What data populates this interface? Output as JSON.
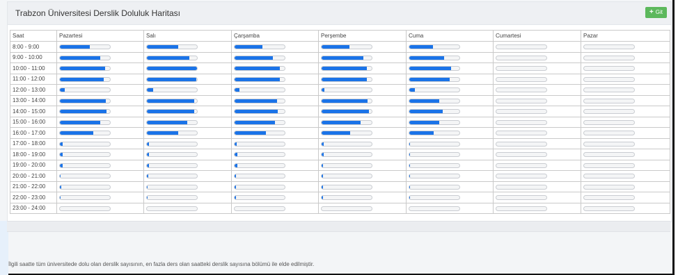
{
  "page": {
    "title": "Trabzon Üniversitesi Derslik Doluluk Haritası",
    "go_button": "Git",
    "note": "İlgili saatte tüm üniversitede dolu olan derslik sayısının, en fazla ders olan saatteki derslik sayısına bölümü ile elde edilmiştir."
  },
  "colors": {
    "bar_fill": "#1a73e8",
    "button": "#5cb85c"
  },
  "table": {
    "columns": [
      "Saat",
      "Pazartesi",
      "Salı",
      "Çarşamba",
      "Perşembe",
      "Cuma",
      "Cumartesi",
      "Pazar"
    ],
    "rows": [
      {
        "time": "8:00 - 9:00",
        "values": [
          0.6,
          0.62,
          0.55,
          0.55,
          0.47,
          0.0,
          0.0
        ]
      },
      {
        "time": "9:00 - 10:00",
        "values": [
          0.8,
          0.85,
          0.77,
          0.83,
          0.7,
          0.0,
          0.0
        ]
      },
      {
        "time": "10:00 - 11:00",
        "values": [
          0.9,
          1.0,
          0.9,
          0.9,
          0.84,
          0.0,
          0.0
        ]
      },
      {
        "time": "11:00 - 12:00",
        "values": [
          0.88,
          0.98,
          0.9,
          0.9,
          0.8,
          0.0,
          0.0
        ]
      },
      {
        "time": "12:00 - 13:00",
        "values": [
          0.1,
          0.13,
          0.1,
          0.06,
          0.11,
          0.0,
          0.0
        ]
      },
      {
        "time": "13:00 - 14:00",
        "values": [
          0.92,
          0.95,
          0.85,
          0.92,
          0.6,
          0.0,
          0.0
        ]
      },
      {
        "time": "14:00 - 15:00",
        "values": [
          0.93,
          0.95,
          0.86,
          0.95,
          0.67,
          0.0,
          0.0
        ]
      },
      {
        "time": "15:00 - 16:00",
        "values": [
          0.8,
          0.8,
          0.8,
          0.78,
          0.6,
          0.0,
          0.0
        ]
      },
      {
        "time": "16:00 - 17:00",
        "values": [
          0.66,
          0.63,
          0.62,
          0.57,
          0.48,
          0.0,
          0.0
        ]
      },
      {
        "time": "17:00 - 18:00",
        "values": [
          0.05,
          0.04,
          0.04,
          0.04,
          0.02,
          0.0,
          0.0
        ]
      },
      {
        "time": "18:00 - 19:00",
        "values": [
          0.05,
          0.04,
          0.05,
          0.04,
          0.02,
          0.0,
          0.0
        ]
      },
      {
        "time": "19:00 - 20:00",
        "values": [
          0.05,
          0.04,
          0.05,
          0.03,
          0.02,
          0.0,
          0.0
        ]
      },
      {
        "time": "20:00 - 21:00",
        "values": [
          0.02,
          0.03,
          0.03,
          0.03,
          0.02,
          0.0,
          0.0
        ]
      },
      {
        "time": "21:00 - 22:00",
        "values": [
          0.03,
          0.02,
          0.03,
          0.03,
          0.02,
          0.0,
          0.0
        ]
      },
      {
        "time": "22:00 - 23:00",
        "values": [
          0.02,
          0.01,
          0.03,
          0.03,
          0.01,
          0.0,
          0.0
        ]
      },
      {
        "time": "23:00 - 24:00",
        "values": [
          0.0,
          0.0,
          0.0,
          0.0,
          0.0,
          0.0,
          0.0
        ]
      }
    ]
  }
}
